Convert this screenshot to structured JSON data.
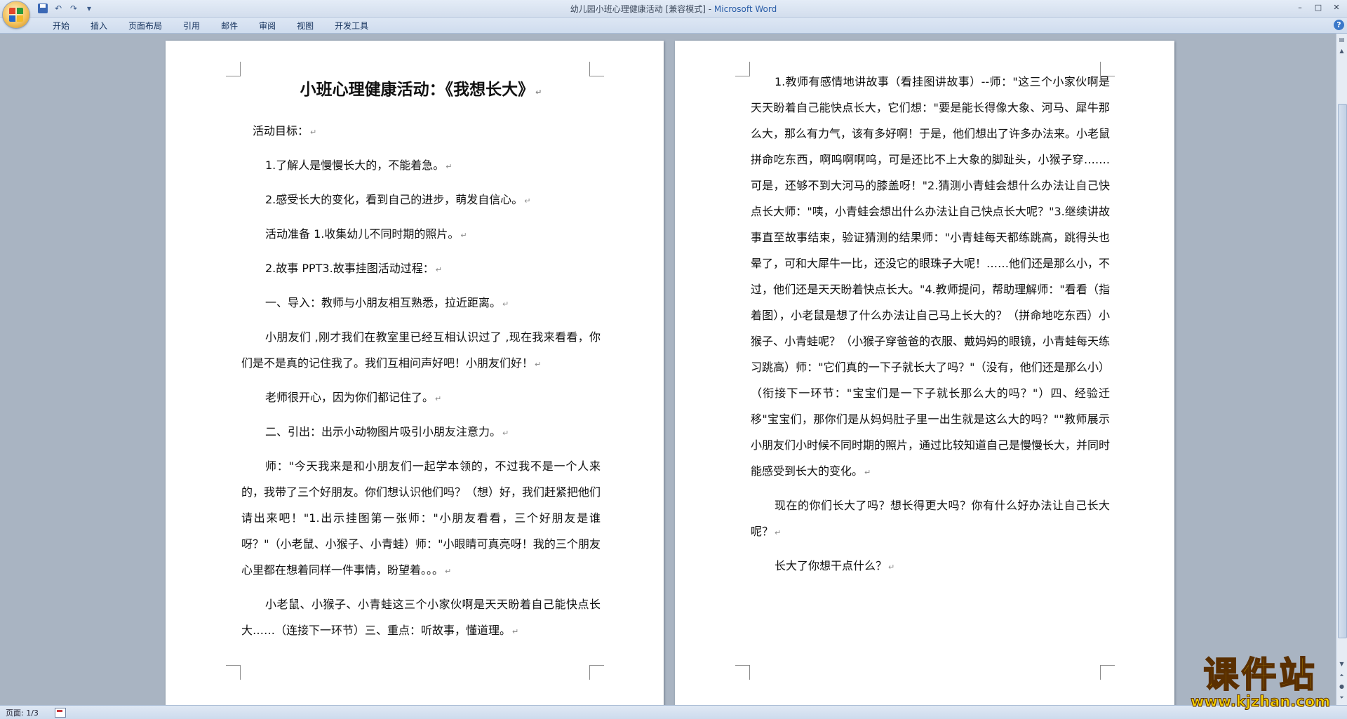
{
  "window": {
    "title": "幼儿园小班心理健康活动 [兼容模式] - ",
    "app_name": "Microsoft Word",
    "controls": [
      "–",
      "□",
      "✕"
    ]
  },
  "qat": {
    "undo": "↶",
    "redo": "↷",
    "more": "▾"
  },
  "ribbon": {
    "tabs": [
      "开始",
      "插入",
      "页面布局",
      "引用",
      "邮件",
      "审阅",
      "视图",
      "开发工具"
    ],
    "help": "?"
  },
  "page1": {
    "heading": "小班心理健康活动：《我想长大》",
    "paragraphs": [
      "活动目标：",
      "1.了解人是慢慢长大的，不能着急。",
      "2.感受长大的变化，看到自己的进步，萌发自信心。",
      "活动准备 1.收集幼儿不同时期的照片。",
      "2.故事 PPT3.故事挂图活动过程：",
      "一、导入：教师与小朋友相互熟悉，拉近距离。",
      "小朋友们 ,刚才我们在教室里已经互相认识过了 ,现在我来看看，你们是不是真的记住我了。我们互相问声好吧！小朋友们好！",
      "老师很开心，因为你们都记住了。",
      "二、引出：出示小动物图片吸引小朋友注意力。",
      "师：\"今天我来是和小朋友们一起学本领的，不过我不是一个人来的，我带了三个好朋友。你们想认识他们吗？（想）好，我们赶紧把他们请出来吧！\"1.出示挂图第一张师：\"小朋友看看，三个好朋友是谁呀？\"（小老鼠、小猴子、小青蛙）师：\"小眼睛可真亮呀！我的三个朋友心里都在想着同样一件事情，盼望着。。。",
      "小老鼠、小猴子、小青蛙这三个小家伙啊是天天盼着自己能快点长大……（连接下一环节）三、重点：听故事，懂道理。"
    ]
  },
  "page2": {
    "paragraphs": [
      "1.教师有感情地讲故事（看挂图讲故事）--师：\"这三个小家伙啊是天天盼着自己能快点长大，它们想：\"要是能长得像大象、河马、犀牛那么大，那么有力气，该有多好啊！于是，他们想出了许多办法来。小老鼠拼命吃东西，啊呜啊啊呜，可是还比不上大象的脚趾头，小猴子穿…….可是，还够不到大河马的膝盖呀！\"2.猜测小青蛙会想什么办法让自己快点长大师：\"咦，小青蛙会想出什么办法让自己快点长大呢？\"3.继续讲故事直至故事结束，验证猜测的结果师：\"小青蛙每天都练跳高，跳得头也晕了，可和大犀牛一比，还没它的眼珠子大呢！……他们还是那么小，不过，他们还是天天盼着快点长大。\"4.教师提问，帮助理解师：\"看看（指着图），小老鼠是想了什么办法让自己马上长大的？（拼命地吃东西）小猴子、小青蛙呢？（小猴子穿爸爸的衣服、戴妈妈的眼镜，小青蛙每天练习跳高）师：\"它们真的一下子就长大了吗？\"（没有，他们还是那么小）（衔接下一环节：\"宝宝们是一下子就长那么大的吗？\"）四、经验迁移\"宝宝们，那你们是从妈妈肚子里一出生就是这么大的吗？\"\"教师展示小朋友们小时候不同时期的照片，通过比较知道自己是慢慢长大，并同时能感受到长大的变化。",
      "现在的你们长大了吗？想长得更大吗？你有什么好办法让自己长大呢？",
      "长大了你想干点什么？"
    ]
  },
  "paragraph_mark": "↵",
  "status": {
    "page": "页面: 1/3"
  },
  "watermark": {
    "brand": "课件站",
    "url": "www.kjzhan.com"
  }
}
